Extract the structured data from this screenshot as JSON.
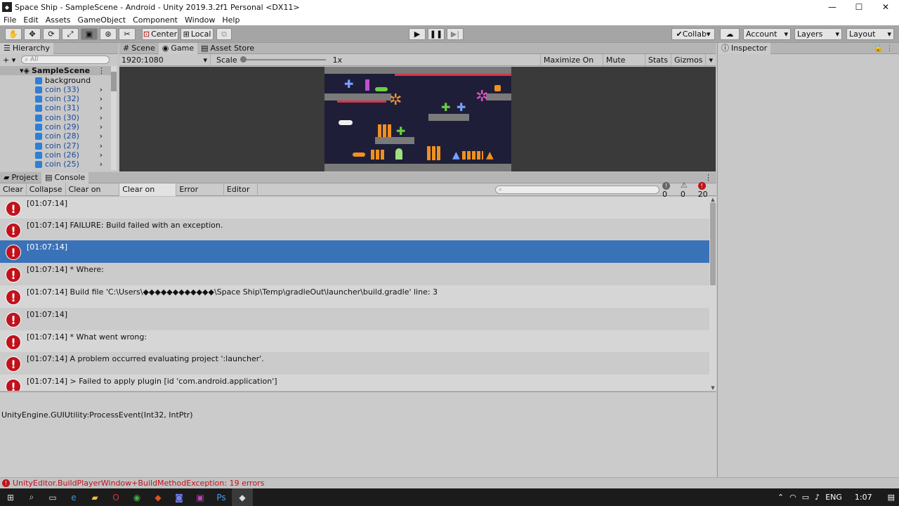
{
  "window": {
    "title": "Space Ship - SampleScene - Android - Unity 2019.3.2f1 Personal <DX11>",
    "minimize": "—",
    "maximize": "☐",
    "close": "✕"
  },
  "menu": [
    "File",
    "Edit",
    "Assets",
    "GameObject",
    "Component",
    "Window",
    "Help"
  ],
  "toolbar": {
    "center_label": "Center",
    "local_label": "Local",
    "collab_label": "Collab",
    "account_label": "Account",
    "layers_label": "Layers",
    "layout_label": "Layout"
  },
  "hierarchy": {
    "tab": "Hierarchy",
    "search_placeholder": "All",
    "scene": "SampleScene",
    "items": [
      "background",
      "coin (33)",
      "coin (32)",
      "coin (31)",
      "coin (30)",
      "coin (29)",
      "coin (28)",
      "coin (27)",
      "coin (26)",
      "coin (25)"
    ]
  },
  "scene_tabs": {
    "scene": "Scene",
    "game": "Game",
    "asset_store": "Asset Store"
  },
  "game_bar": {
    "resolution": "1920:1080",
    "scale_label": "Scale",
    "scale_value": "1x",
    "maximize": "Maximize On Play",
    "mute": "Mute Audio",
    "stats": "Stats",
    "gizmos": "Gizmos"
  },
  "inspector": {
    "tab": "Inspector"
  },
  "bottom_tabs": {
    "project": "Project",
    "console": "Console"
  },
  "console": {
    "clear": "Clear",
    "collapse": "Collapse",
    "clear_on_play": "Clear on Play",
    "clear_on_build": "Clear on Build",
    "error_pause": "Error Pause",
    "editor": "Editor",
    "info_count": "0",
    "warn_count": "0",
    "error_count": "20",
    "logs": [
      "[01:07:14]",
      "[01:07:14] FAILURE: Build failed with an exception.",
      "[01:07:14]",
      "[01:07:14] * Where:",
      "[01:07:14] Build file 'C:\\Users\\◆◆◆◆◆◆◆◆◆◆◆◆\\Space Ship\\Temp\\gradleOut\\launcher\\build.gradle' line: 3",
      "[01:07:14]",
      "[01:07:14] * What went wrong:",
      "[01:07:14] A problem occurred evaluating project ':launcher'.",
      "[01:07:14] > Failed to apply plugin [id 'com.android.application']"
    ],
    "detail": "UnityEngine.GUIUtility:ProcessEvent(Int32, IntPtr)"
  },
  "status": {
    "message": "UnityEditor.BuildPlayerWindow+BuildMethodException: 19 errors"
  },
  "taskbar": {
    "lang": "ENG",
    "time": "1:07"
  },
  "colors": {
    "selection": "#3a72b8",
    "error": "#c0121c",
    "game_bg": "#1e1e38"
  }
}
